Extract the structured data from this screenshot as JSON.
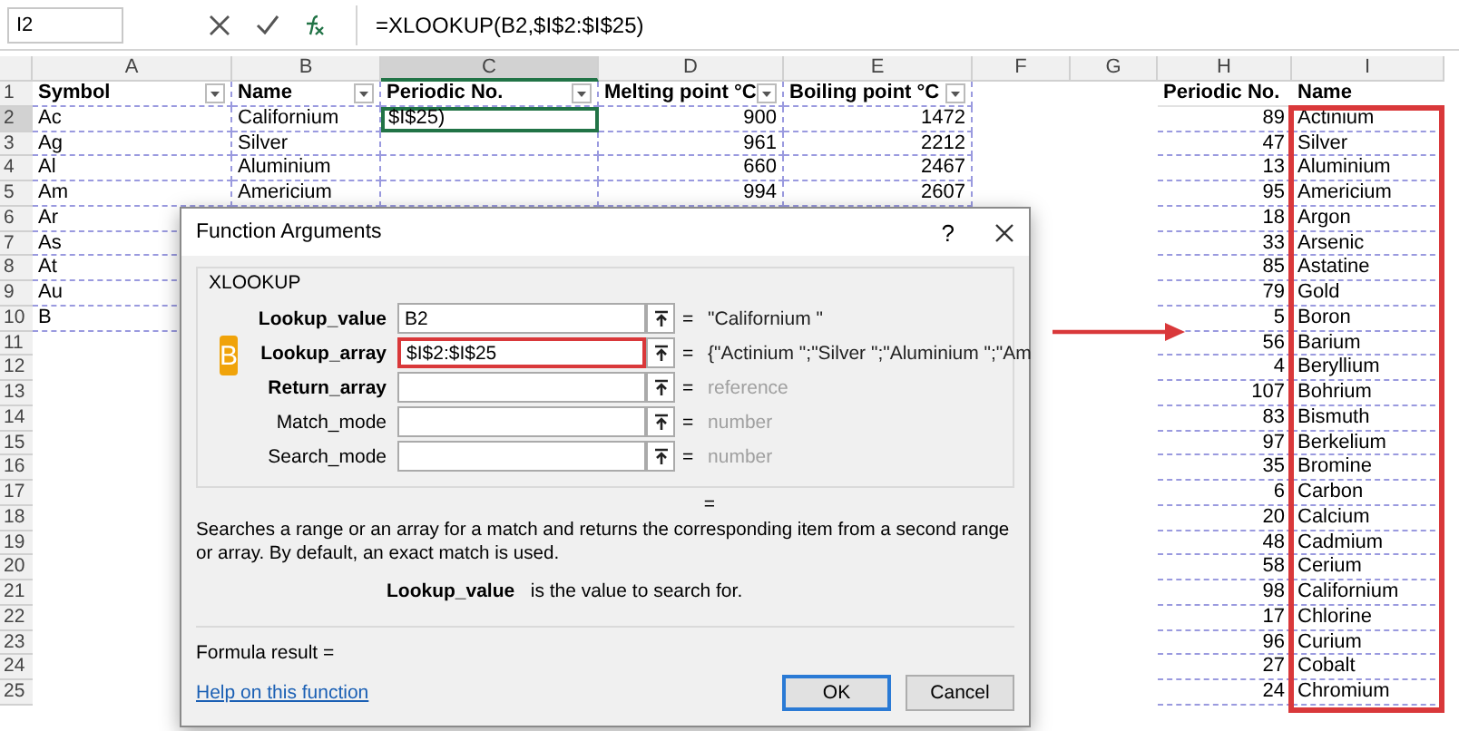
{
  "formula_bar": {
    "name_box": "I2",
    "formula": "=XLOOKUP(B2,$I$2:$I$25)"
  },
  "column_headers": [
    {
      "label": "A",
      "selected": false
    },
    {
      "label": "B",
      "selected": false
    },
    {
      "label": "C",
      "selected": true
    },
    {
      "label": "D",
      "selected": false
    },
    {
      "label": "E",
      "selected": false
    },
    {
      "label": "F",
      "selected": false
    },
    {
      "label": "G",
      "selected": false
    },
    {
      "label": "H",
      "selected": false
    },
    {
      "label": "I",
      "selected": false
    }
  ],
  "row_headers": [
    {
      "label": "1",
      "selected": false
    },
    {
      "label": "2",
      "selected": true
    },
    {
      "label": "3",
      "selected": false
    },
    {
      "label": "4",
      "selected": false
    },
    {
      "label": "5",
      "selected": false
    },
    {
      "label": "6",
      "selected": false
    },
    {
      "label": "7",
      "selected": false
    },
    {
      "label": "8",
      "selected": false
    },
    {
      "label": "9",
      "selected": false
    },
    {
      "label": "10",
      "selected": false
    },
    {
      "label": "11",
      "selected": false
    },
    {
      "label": "12",
      "selected": false
    },
    {
      "label": "13",
      "selected": false
    },
    {
      "label": "14",
      "selected": false
    },
    {
      "label": "15",
      "selected": false
    },
    {
      "label": "16",
      "selected": false
    },
    {
      "label": "17",
      "selected": false
    },
    {
      "label": "18",
      "selected": false
    },
    {
      "label": "19",
      "selected": false
    },
    {
      "label": "20",
      "selected": false
    },
    {
      "label": "21",
      "selected": false
    },
    {
      "label": "22",
      "selected": false
    },
    {
      "label": "23",
      "selected": false
    },
    {
      "label": "24",
      "selected": false
    },
    {
      "label": "25",
      "selected": false
    }
  ],
  "elements_table": {
    "columns": [
      "Symbol",
      "Name",
      "Periodic No.",
      "Melting point °C",
      "Boiling point °C"
    ],
    "rows": [
      [
        "Ac",
        "Californium",
        "$I$25)",
        "900",
        "1472"
      ],
      [
        "Ag",
        "Silver",
        "",
        "961",
        "2212"
      ],
      [
        "Al",
        "Aluminium",
        "",
        "660",
        "2467"
      ],
      [
        "Am",
        "Americium",
        "",
        "994",
        "2607"
      ],
      [
        "Ar"
      ],
      [
        "As"
      ],
      [
        "At"
      ],
      [
        "Au"
      ],
      [
        "B"
      ]
    ]
  },
  "lookup_table": {
    "columns": [
      "Periodic No.",
      "Name"
    ],
    "rows": [
      [
        "89",
        "Actinium"
      ],
      [
        "47",
        "Silver"
      ],
      [
        "13",
        "Aluminium"
      ],
      [
        "95",
        "Americium"
      ],
      [
        "18",
        "Argon"
      ],
      [
        "33",
        "Arsenic"
      ],
      [
        "85",
        "Astatine"
      ],
      [
        "79",
        "Gold"
      ],
      [
        "5",
        "Boron"
      ],
      [
        "56",
        "Barium"
      ],
      [
        "4",
        "Beryllium"
      ],
      [
        "107",
        "Bohrium"
      ],
      [
        "83",
        "Bismuth"
      ],
      [
        "97",
        "Berkelium"
      ],
      [
        "35",
        "Bromine"
      ],
      [
        "6",
        "Carbon"
      ],
      [
        "20",
        "Calcium"
      ],
      [
        "48",
        "Cadmium"
      ],
      [
        "58",
        "Cerium"
      ],
      [
        "98",
        "Californium"
      ],
      [
        "17",
        "Chlorine"
      ],
      [
        "96",
        "Curium"
      ],
      [
        "27",
        "Cobalt"
      ],
      [
        "24",
        "Chromium"
      ]
    ]
  },
  "dialog": {
    "title": "Function Arguments",
    "help": "?",
    "function_name": "XLOOKUP",
    "badge": "B",
    "arguments": [
      {
        "label": "Lookup_value",
        "required": true,
        "value": "B2",
        "highlighted": false,
        "result": "\"Californium \"",
        "hint": false
      },
      {
        "label": "Lookup_array",
        "required": true,
        "value": "$I$2:$I$25",
        "highlighted": true,
        "result": "{\"Actinium \";\"Silver \";\"Aluminium \";\"Am",
        "hint": false
      },
      {
        "label": "Return_array",
        "required": true,
        "highlighted": false,
        "result": "reference",
        "hint": true
      },
      {
        "label": "Match_mode",
        "required": false,
        "highlighted": false,
        "result": "number",
        "hint": true
      },
      {
        "label": "Search_mode",
        "required": false,
        "highlighted": false,
        "result": "number",
        "hint": true
      }
    ],
    "equals": "=",
    "description": "Searches a range or an array for a match and returns the corresponding item from a second range or array. By default, an exact match is used.",
    "argument_name": "Lookup_value",
    "argument_help": "is the value to search for.",
    "formula_result": "Formula result =",
    "help_link": "Help on this function",
    "buttons": [
      {
        "label": "OK",
        "default": true
      },
      {
        "label": "Cancel",
        "default": false
      }
    ]
  }
}
